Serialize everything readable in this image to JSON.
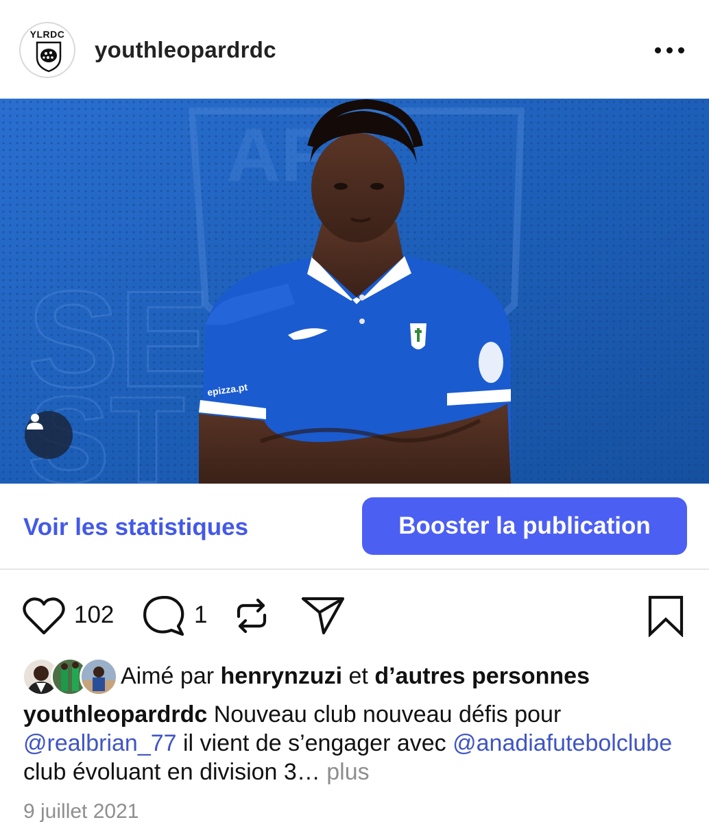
{
  "header": {
    "avatar_text": "YLRDC",
    "username": "youthleopardrdc",
    "more_icon": "more-horizontal-icon"
  },
  "post": {
    "image_icon_user_tag": "user-tag-icon",
    "stats_link": "Voir les statistiques",
    "boost_button": "Booster la publication"
  },
  "actions": {
    "like_icon": "heart-icon",
    "like_count": "102",
    "comment_icon": "comment-icon",
    "comment_count": "1",
    "repost_icon": "repost-icon",
    "share_icon": "send-icon",
    "save_icon": "bookmark-icon"
  },
  "likes": {
    "prefix": "Aimé par ",
    "user": "henrynzuzi",
    "middle": " et ",
    "others": "d’autres personnes"
  },
  "caption": {
    "username": "youthleopardrdc",
    "text1": " Nouveau club nouveau défis pour ",
    "mention1": "@realbrian_77",
    "text2": " il vient de s’engager avec ",
    "mention2": "@anadiafutebolclube",
    "text3": " club évoluant en division 3… ",
    "more": "plus"
  },
  "date": "9 juillet 2021",
  "colors": {
    "accent": "#4c5ff3",
    "link": "#4359e8",
    "mention": "#3f54c6",
    "jersey": "#1a5bd0",
    "background_blue": "#1d5fb8"
  }
}
